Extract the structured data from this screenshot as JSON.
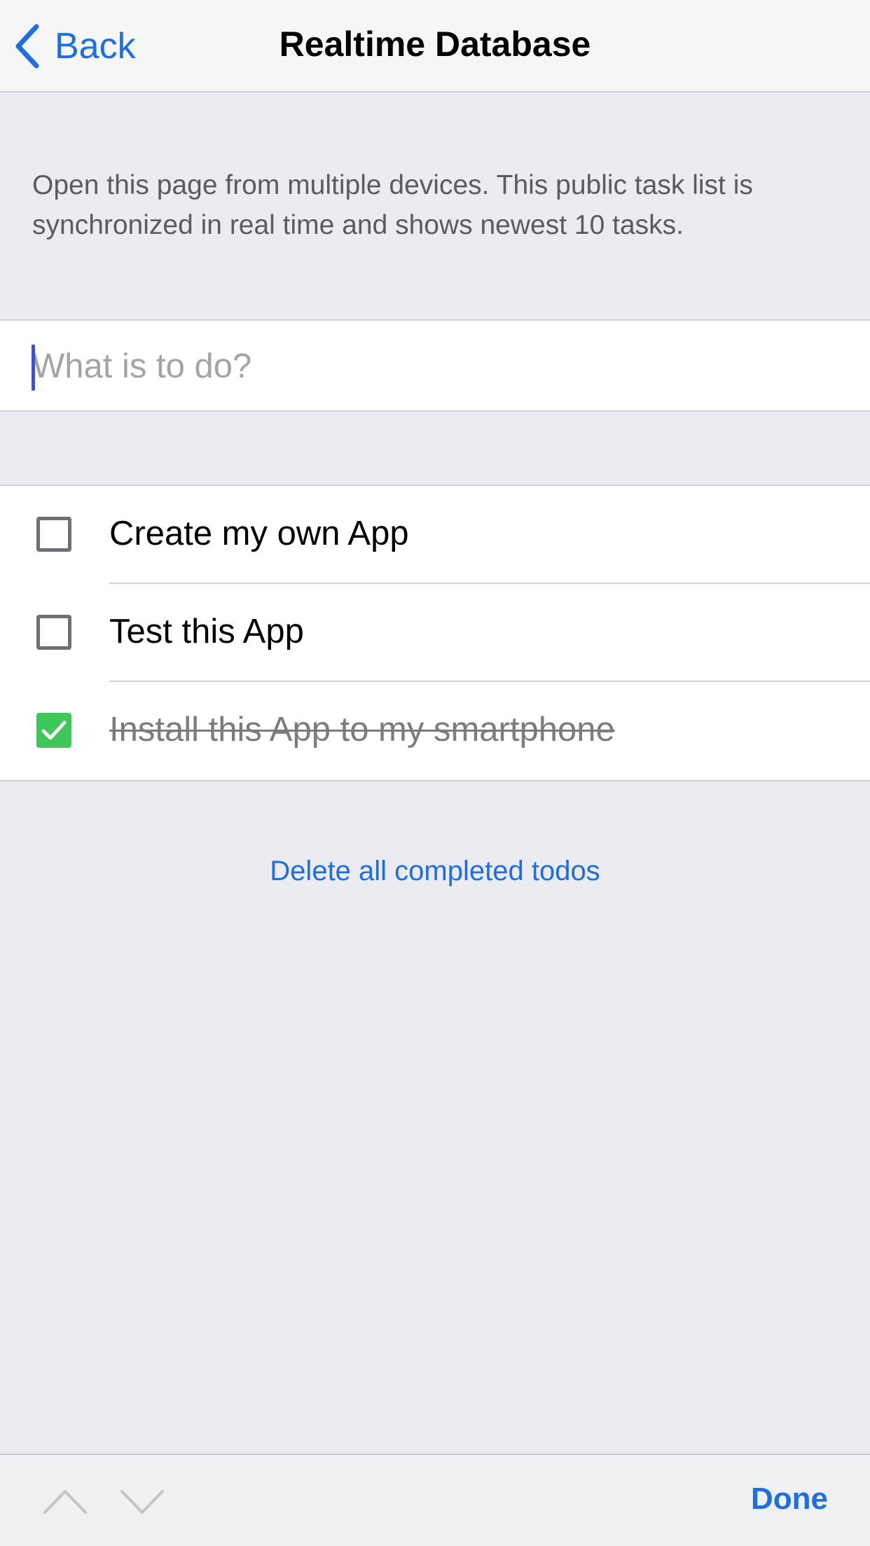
{
  "navbar": {
    "back_label": "Back",
    "title": "Realtime Database"
  },
  "description": "Open this page from multiple devices. This public task list is synchronized in real time and shows newest 10 tasks.",
  "input": {
    "placeholder": "What is to do?",
    "value": ""
  },
  "todos": [
    {
      "label": "Create my own App",
      "completed": false
    },
    {
      "label": "Test this App",
      "completed": false
    },
    {
      "label": "Install this App to my smartphone",
      "completed": true
    }
  ],
  "delete_completed_label": "Delete all completed todos",
  "toolbar": {
    "up_icon": "chevron-up-icon",
    "down_icon": "chevron-down-icon",
    "done_label": "Done"
  },
  "colors": {
    "accent": "#1d6de3",
    "check_green": "#3cc758",
    "background": "#ebebf1"
  }
}
